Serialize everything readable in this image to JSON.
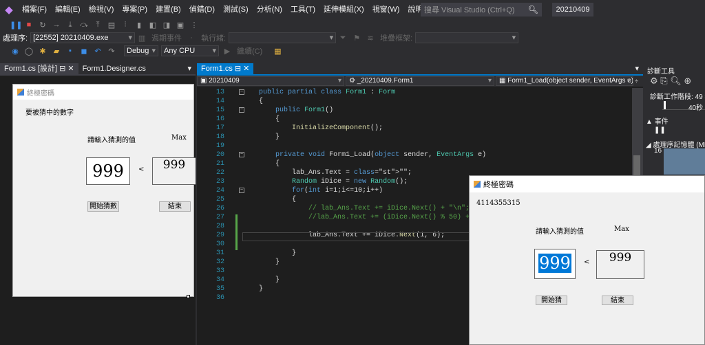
{
  "menu": {
    "items": [
      "檔案(F)",
      "編輯(E)",
      "檢視(V)",
      "專案(P)",
      "建置(B)",
      "偵錯(D)",
      "測試(S)",
      "分析(N)",
      "工具(T)",
      "延伸模組(X)",
      "視窗(W)",
      "說明(H)"
    ],
    "search_placeholder": "搜尋 Visual Studio (Ctrl+Q)",
    "solution_name": "20210409"
  },
  "toolbar": {
    "process_label": "處理序:",
    "process_value": "[22552] 20210409.exe",
    "lifecycle_label": "週期事件",
    "thread_label": "執行緒:",
    "stackframe_label": "堆疊框架:",
    "config_value": "Debug",
    "platform_value": "Any CPU",
    "continue_label": "繼續(C)"
  },
  "tabs": {
    "left": [
      "Form1.cs [設計]",
      "Form1.Designer.cs"
    ],
    "right": [
      "Form1.cs"
    ]
  },
  "designer_form": {
    "title": "終極密碼",
    "hint": "要被猜中的數字",
    "prompt": "請輸入猜測的值",
    "max_label": "Max",
    "input_value": "999",
    "lt": "<",
    "max_value": "999",
    "start_button": "開始猜數",
    "end_button": "結束"
  },
  "navbar": {
    "project": "20210409",
    "class": "_20210409.Form1",
    "method": "Form1_Load(object sender, EventArgs e)"
  },
  "code_lines": [
    {
      "n": "13",
      "t": "public partial class Form1 : Form"
    },
    {
      "n": "14",
      "t": "{"
    },
    {
      "n": "15",
      "t": "    public Form1()"
    },
    {
      "n": "16",
      "t": "    {"
    },
    {
      "n": "17",
      "t": "        InitializeComponent();"
    },
    {
      "n": "18",
      "t": "    }"
    },
    {
      "n": "19",
      "t": ""
    },
    {
      "n": "20",
      "t": "    private void Form1_Load(object sender, EventArgs e)"
    },
    {
      "n": "21",
      "t": "    {"
    },
    {
      "n": "22",
      "t": "        lab_Ans.Text = \"\";"
    },
    {
      "n": "23",
      "t": "        Random iDice = new Random();"
    },
    {
      "n": "24",
      "t": "        for(int i=1;i<=10;i++)"
    },
    {
      "n": "25",
      "t": "        {"
    },
    {
      "n": "26",
      "t": "            // lab_Ans.Text += iDice.Next() + \"\\n\";"
    },
    {
      "n": "27",
      "t": "            //lab_Ans.Text += (iDice.Next() % 50) + 50;"
    },
    {
      "n": "28",
      "t": ""
    },
    {
      "n": "29",
      "t": "            lab_Ans.Text += iDice.Next(1, 6);"
    },
    {
      "n": "30",
      "t": ""
    },
    {
      "n": "31",
      "t": "        }"
    },
    {
      "n": "32",
      "t": "    }"
    },
    {
      "n": "33",
      "t": ""
    },
    {
      "n": "34",
      "t": "    }"
    },
    {
      "n": "35",
      "t": "}"
    },
    {
      "n": "36",
      "t": ""
    }
  ],
  "diagnostics": {
    "title": "診斷工具",
    "session": "診斷工作階段: 49 秒",
    "seconds": "40秒",
    "events": "事件",
    "memory": "處理序記憶體 (MB)",
    "mem_value": "16"
  },
  "run_form": {
    "title": "終極密碼",
    "answer": "4114355315",
    "prompt": "請輸入猜測的值",
    "max_label": "Max",
    "input_value": "999",
    "lt": "<",
    "max_value": "999",
    "start_button": "開始猜",
    "end_button": "結束"
  }
}
